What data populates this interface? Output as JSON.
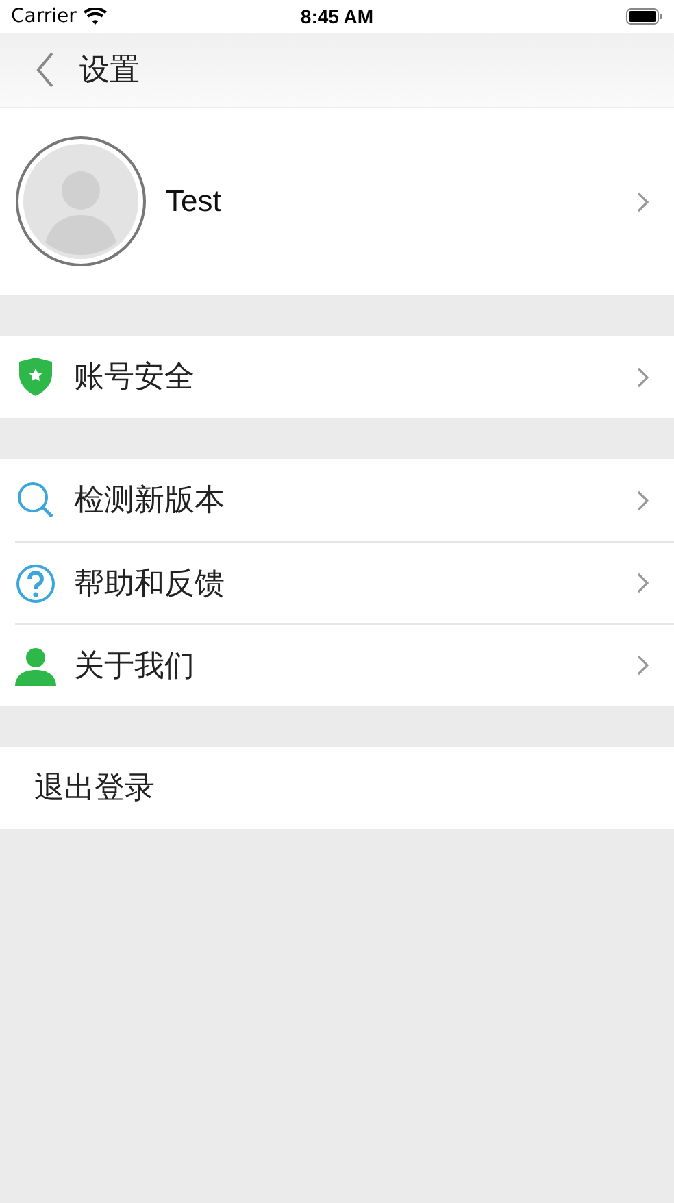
{
  "status_bar": {
    "carrier": "Carrier",
    "time": "8:45 AM"
  },
  "nav_bar": {
    "title": "设置"
  },
  "profile": {
    "name": "Test"
  },
  "groups": [
    {
      "items": [
        {
          "kind": "shield",
          "label": "账号安全"
        }
      ]
    },
    {
      "items": [
        {
          "kind": "search",
          "label": "检测新版本"
        },
        {
          "kind": "help",
          "label": "帮助和反馈"
        },
        {
          "kind": "person",
          "label": "关于我们"
        }
      ]
    }
  ],
  "logout": {
    "label": "退出登录"
  }
}
